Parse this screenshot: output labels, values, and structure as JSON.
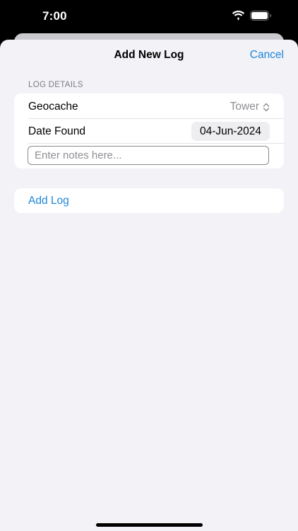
{
  "status_bar": {
    "time": "7:00"
  },
  "nav": {
    "title": "Add New Log",
    "cancel_label": "Cancel"
  },
  "form": {
    "section_header": "LOG DETAILS",
    "geocache": {
      "label": "Geocache",
      "value": "Tower"
    },
    "date_found": {
      "label": "Date Found",
      "value": "04-Jun-2024"
    },
    "notes": {
      "value": "",
      "placeholder": "Enter notes here..."
    }
  },
  "actions": {
    "add_log_label": "Add Log"
  },
  "colors": {
    "accent": "#1f86d9",
    "background": "#f2f2f7",
    "card": "#ffffff",
    "secondary_text": "#8e8e93"
  },
  "icons": [
    "wifi-icon",
    "battery-icon",
    "chevron-updown-icon"
  ]
}
